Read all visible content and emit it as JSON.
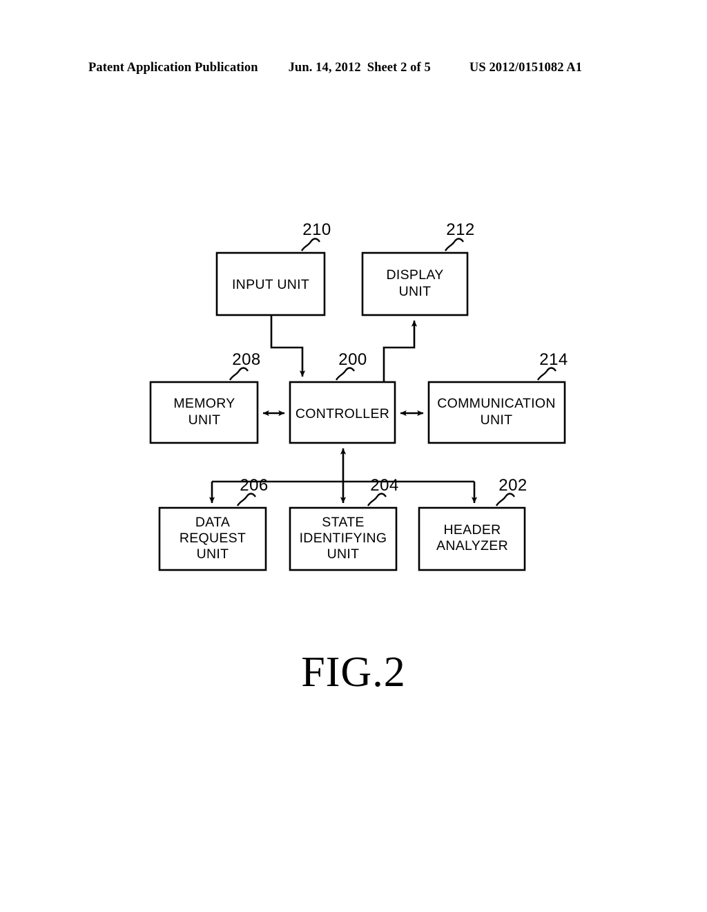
{
  "header": {
    "publication": "Patent Application Publication",
    "date": "Jun. 14, 2012",
    "sheet": "Sheet 2 of 5",
    "patent_number": "US 2012/0151082 A1"
  },
  "figure": {
    "caption": "FIG.2",
    "blocks": [
      {
        "id": "input-unit",
        "ref": "210",
        "lines": [
          "INPUT UNIT"
        ]
      },
      {
        "id": "display-unit",
        "ref": "212",
        "lines": [
          "DISPLAY",
          "UNIT"
        ]
      },
      {
        "id": "memory-unit",
        "ref": "208",
        "lines": [
          "MEMORY",
          "UNIT"
        ]
      },
      {
        "id": "controller",
        "ref": "200",
        "lines": [
          "CONTROLLER"
        ]
      },
      {
        "id": "communication-unit",
        "ref": "214",
        "lines": [
          "COMMUNICATION",
          "UNIT"
        ]
      },
      {
        "id": "data-request-unit",
        "ref": "206",
        "lines": [
          "DATA",
          "REQUEST",
          "UNIT"
        ]
      },
      {
        "id": "state-identifying-unit",
        "ref": "204",
        "lines": [
          "STATE",
          "IDENTIFYING",
          "UNIT"
        ]
      },
      {
        "id": "header-analyzer",
        "ref": "202",
        "lines": [
          "HEADER",
          "ANALYZER"
        ]
      }
    ],
    "connections": [
      {
        "from": "input-unit",
        "to": "controller",
        "arrow": "single"
      },
      {
        "from": "controller",
        "to": "display-unit",
        "arrow": "single"
      },
      {
        "from": "memory-unit",
        "to": "controller",
        "arrow": "double"
      },
      {
        "from": "controller",
        "to": "communication-unit",
        "arrow": "double"
      },
      {
        "from": "controller",
        "to": "state-identifying-unit",
        "arrow": "double"
      },
      {
        "from": "controller",
        "to": "data-request-unit",
        "arrow": "single"
      },
      {
        "from": "controller",
        "to": "header-analyzer",
        "arrow": "single"
      }
    ]
  },
  "colors": {
    "ink": "#000000",
    "paper": "#ffffff"
  }
}
